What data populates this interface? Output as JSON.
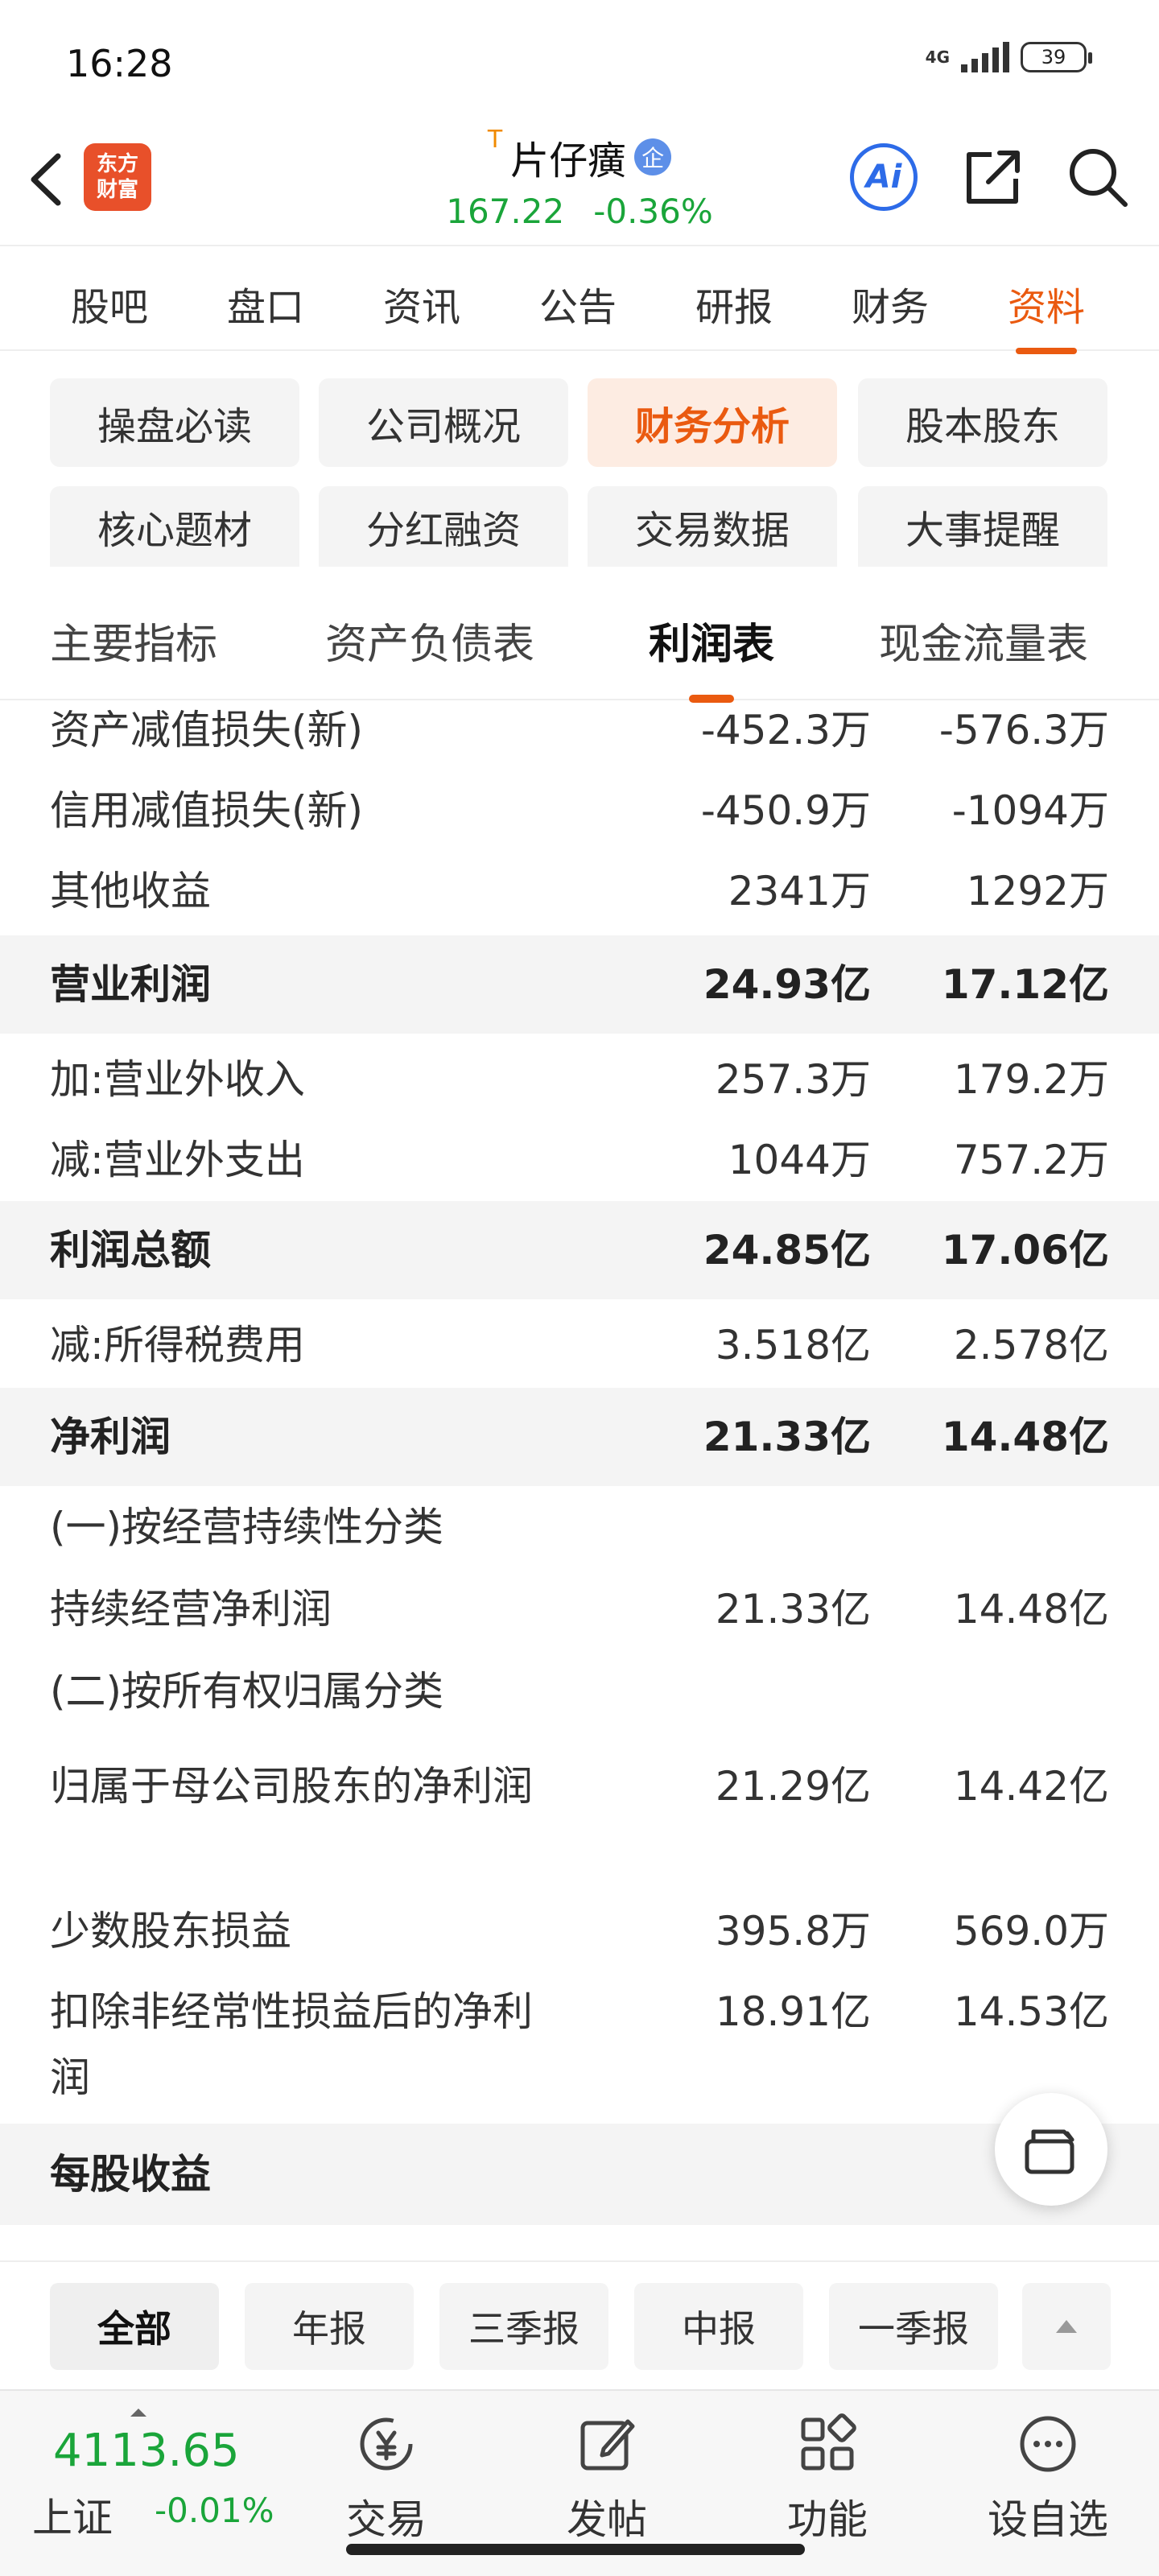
{
  "status_bar": {
    "time": "16:28",
    "network": "4G",
    "battery": "39"
  },
  "header": {
    "logo_line1": "东方",
    "logo_line2": "财富",
    "stock_prefix": "T",
    "stock_name": "片仔癀",
    "stock_badge": "企",
    "price": "167.22",
    "change_pct": "-0.36%",
    "ai_label": "Ai"
  },
  "main_tabs": [
    "股吧",
    "盘口",
    "资讯",
    "公告",
    "研报",
    "财务",
    "资料"
  ],
  "main_tab_active": "资料",
  "chips": [
    "操盘必读",
    "公司概况",
    "财务分析",
    "股本股东",
    "核心题材",
    "分红融资",
    "交易数据",
    "大事提醒"
  ],
  "chip_active": "财务分析",
  "sub_tabs": [
    "主要指标",
    "资产负债表",
    "利润表",
    "现金流量表"
  ],
  "sub_tab_active": "利润表",
  "rows": [
    {
      "label": "资产减值损失(新)",
      "v1": "-452.3万",
      "v2": "-576.3万"
    },
    {
      "label": "信用减值损失(新)",
      "v1": "-450.9万",
      "v2": "-1094万"
    },
    {
      "label": "其他收益",
      "v1": "2341万",
      "v2": "1292万"
    },
    {
      "label": "营业利润",
      "v1": "24.93亿",
      "v2": "17.12亿"
    },
    {
      "label": "加:营业外收入",
      "v1": "257.3万",
      "v2": "179.2万"
    },
    {
      "label": "减:营业外支出",
      "v1": "1044万",
      "v2": "757.2万"
    },
    {
      "label": "利润总额",
      "v1": "24.85亿",
      "v2": "17.06亿"
    },
    {
      "label": "减:所得税费用",
      "v1": "3.518亿",
      "v2": "2.578亿"
    },
    {
      "label": "净利润",
      "v1": "21.33亿",
      "v2": "14.48亿"
    },
    {
      "label": "(一)按经营持续性分类",
      "v1": "",
      "v2": ""
    },
    {
      "label": "持续经营净利润",
      "v1": "21.33亿",
      "v2": "14.48亿"
    },
    {
      "label": "(二)按所有权归属分类",
      "v1": "",
      "v2": ""
    },
    {
      "label": "归属于母公司股东的净利润",
      "v1": "21.29亿",
      "v2": "14.42亿"
    },
    {
      "label": "少数股东损益",
      "v1": "395.8万",
      "v2": "569.0万"
    },
    {
      "label": "扣除非经常性损益后的净利润",
      "v1": "18.91亿",
      "v2": "14.53亿"
    },
    {
      "label": "每股收益",
      "v1": "",
      "v2": ""
    }
  ],
  "period_filters": [
    "全部",
    "年报",
    "三季报",
    "中报",
    "一季报"
  ],
  "period_active": "全部",
  "bottom_nav": {
    "index_value": "4113.65",
    "index_name": "上证",
    "index_change": "-0.01%",
    "items": [
      "交易",
      "发帖",
      "功能",
      "设自选"
    ]
  },
  "colors": {
    "accent": "#ea5a10",
    "down_green": "#1aa53a",
    "ai_blue": "#2d6be8"
  }
}
